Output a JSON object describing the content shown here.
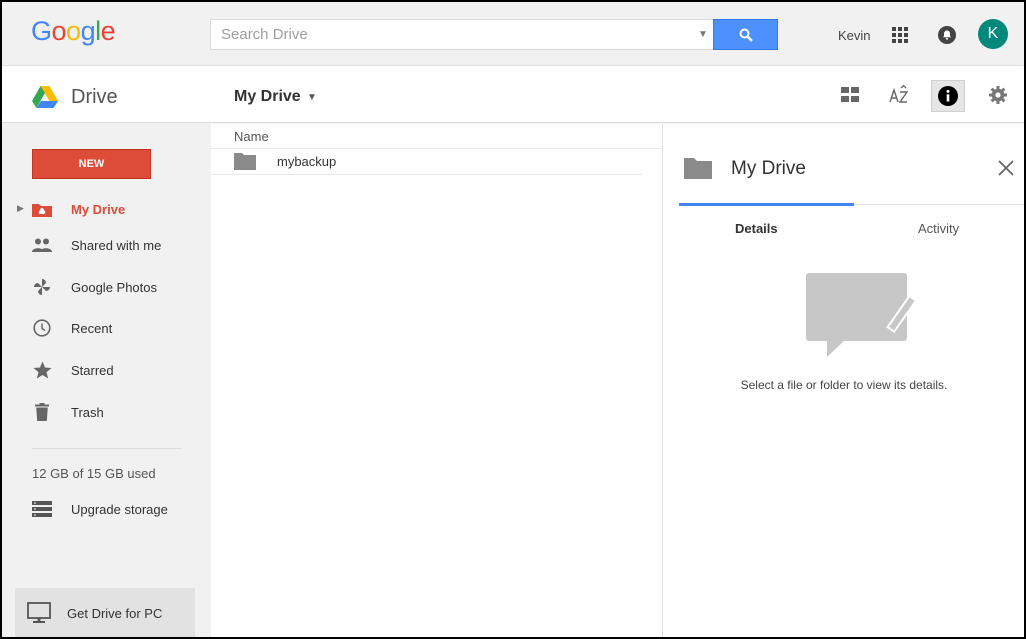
{
  "topbar": {
    "logo": {
      "G": "G",
      "o1": "o",
      "o2": "o",
      "g": "g",
      "l": "l",
      "e": "e"
    },
    "search": {
      "placeholder": "Search Drive"
    },
    "user_name": "Kevin",
    "avatar_letter": "K"
  },
  "subbar": {
    "product": "Drive",
    "breadcrumb": "My Drive"
  },
  "sidebar": {
    "new_label": "NEW",
    "items": [
      {
        "label": "My Drive",
        "icon": "my-drive-icon",
        "active": true
      },
      {
        "label": "Shared with me",
        "icon": "people-icon"
      },
      {
        "label": "Google Photos",
        "icon": "photos-pinwheel-icon"
      },
      {
        "label": "Recent",
        "icon": "clock-icon"
      },
      {
        "label": "Starred",
        "icon": "star-icon"
      },
      {
        "label": "Trash",
        "icon": "trash-icon"
      }
    ],
    "storage": "12 GB of 15 GB used",
    "upgrade": "Upgrade storage",
    "get_drive": "Get Drive for PC"
  },
  "filelist": {
    "column_name": "Name",
    "files": [
      {
        "name": "mybackup",
        "type": "folder"
      }
    ]
  },
  "details": {
    "title": "My Drive",
    "tabs": [
      {
        "label": "Details",
        "active": true
      },
      {
        "label": "Activity"
      }
    ],
    "empty_message": "Select a file or folder to view its details."
  },
  "colors": {
    "new_button": "#dd4b39",
    "search_button": "#4d90fe",
    "active_nav": "#dd4b39",
    "avatar": "#00897b",
    "tab_indicator": "#4285f4"
  }
}
